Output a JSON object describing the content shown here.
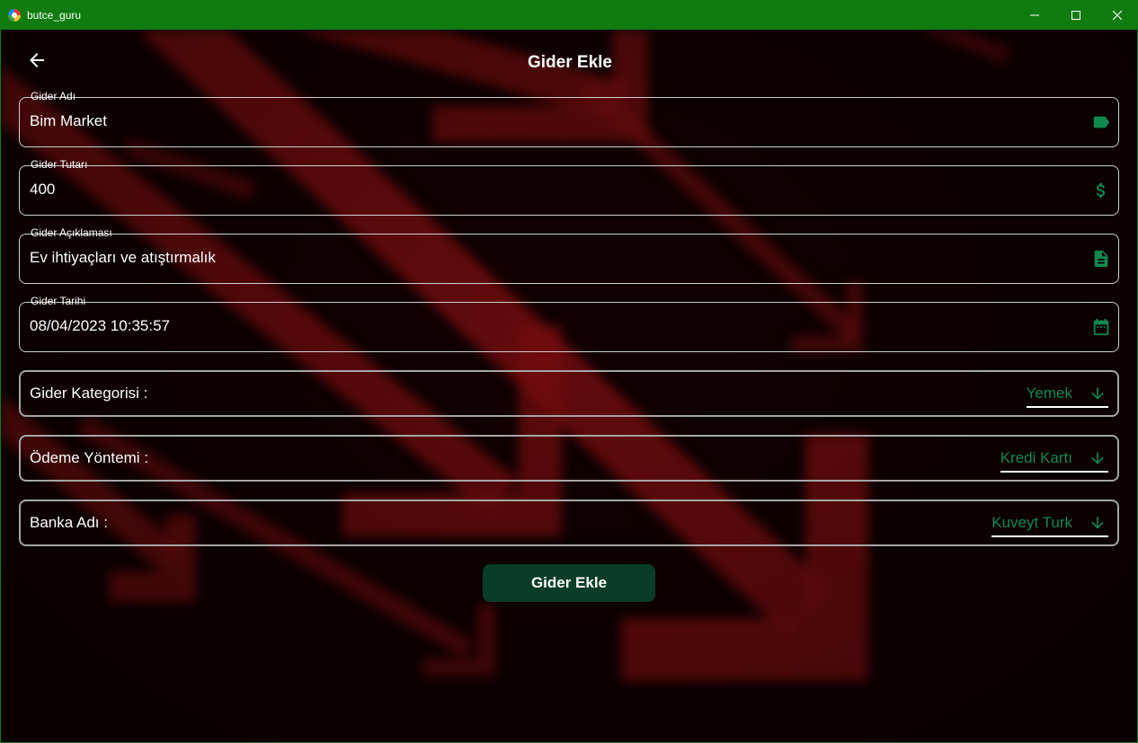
{
  "window": {
    "title": "butce_guru"
  },
  "header": {
    "title": "Gider Ekle"
  },
  "fields": [
    {
      "label": "Gider Adı",
      "value": "Bim Market",
      "icon": "label-icon"
    },
    {
      "label": "Gider Tutarı",
      "value": "400",
      "icon": "dollar-icon"
    },
    {
      "label": "Gider Açıklaması",
      "value": "Ev ihtiyaçları ve atıştırmalık",
      "icon": "document-icon"
    },
    {
      "label": "Gider Tarihi",
      "value": "08/04/2023 10:35:57",
      "icon": "calendar-icon"
    }
  ],
  "selects": [
    {
      "label": "Gider Kategorisi :",
      "value": "Yemek"
    },
    {
      "label": "Ödeme Yöntemi :",
      "value": "Kredi Kartı"
    },
    {
      "label": "Banka Adı :",
      "value": "Kuveyt Turk"
    }
  ],
  "submit_label": "Gider Ekle",
  "colors": {
    "titlebar": "#107c10",
    "accent": "#0f8a4f",
    "button": "#0a3d27",
    "background": "#120001"
  }
}
